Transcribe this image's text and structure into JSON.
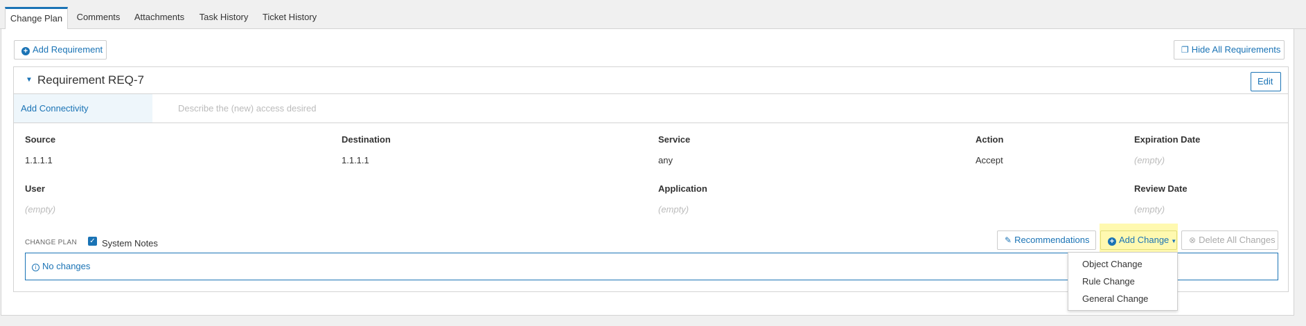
{
  "tabs": [
    {
      "label": "Change Plan",
      "active": true
    },
    {
      "label": "Comments"
    },
    {
      "label": "Attachments"
    },
    {
      "label": "Task History"
    },
    {
      "label": "Ticket History"
    }
  ],
  "toolbar": {
    "add_requirement": "Add Requirement",
    "hide_all_requirements": "Hide All Requirements"
  },
  "requirement": {
    "title": "Requirement REQ-7",
    "edit_label": "Edit",
    "step_label": "Add Connectivity",
    "step_hint": "Describe the (new) access desired",
    "fields": {
      "source": {
        "label": "Source",
        "value": "1.1.1.1"
      },
      "destination": {
        "label": "Destination",
        "value": "1.1.1.1"
      },
      "service": {
        "label": "Service",
        "value": "any"
      },
      "action": {
        "label": "Action",
        "value": "Accept"
      },
      "expiration": {
        "label": "Expiration Date",
        "value": "(empty)"
      },
      "user": {
        "label": "User",
        "value": "(empty)"
      },
      "application": {
        "label": "Application",
        "value": "(empty)"
      },
      "review": {
        "label": "Review Date",
        "value": "(empty)"
      }
    }
  },
  "change_plan": {
    "section_label": "CHANGE PLAN",
    "system_notes_label": "System Notes",
    "system_notes_checked": true,
    "recommendations": "Recommendations",
    "add_change": "Add Change",
    "delete_all": "Delete All Changes",
    "no_changes": "No changes",
    "dropdown": [
      "Object Change",
      "Rule Change",
      "General Change"
    ]
  },
  "colors": {
    "accent": "#1a73b5",
    "highlight": "#fff9b0"
  }
}
